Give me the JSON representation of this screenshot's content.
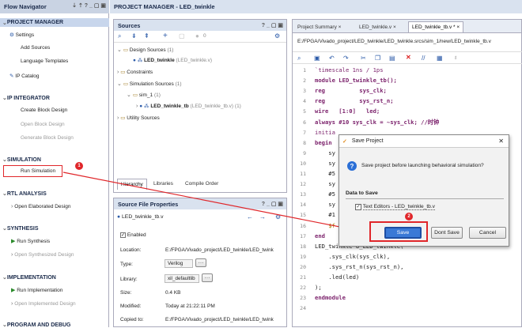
{
  "flow_nav": {
    "title": "Flow Navigator",
    "sections": {
      "project_manager": "PROJECT MANAGER",
      "ip_integrator": "IP INTEGRATOR",
      "simulation": "SIMULATION",
      "rtl_analysis": "RTL ANALYSIS",
      "synthesis": "SYNTHESIS",
      "implementation": "IMPLEMENTATION",
      "program_debug": "PROGRAM AND DEBUG"
    },
    "items": {
      "settings": "Settings",
      "add_sources": "Add Sources",
      "language_templates": "Language Templates",
      "ip_catalog": "IP Catalog",
      "create_block": "Create Block Design",
      "open_block": "Open Block Design",
      "generate_block": "Generate Block Design",
      "run_sim": "Run Simulation",
      "open_elab": "Open Elaborated Design",
      "run_synth": "Run Synthesis",
      "open_synth": "Open Synthesized Design",
      "run_impl": "Run Implementation",
      "open_impl": "Open Implemented Design"
    }
  },
  "pm_header": "PROJECT MANAGER - LED_twinkle",
  "sources": {
    "title": "Sources",
    "count": "0",
    "design_sources": "Design Sources",
    "design_count": "(1)",
    "led_twinkle": "LED_twinkle",
    "led_twinkle_file": "(LED_twinkle.v)",
    "constraints": "Constraints",
    "sim_sources": "Simulation Sources",
    "sim_count": "(1)",
    "sim_1": "sim_1",
    "sim_1_count": "(1)",
    "tb": "LED_twinkle_tb",
    "tb_file": "(LED_twinkle_tb.v) (1)",
    "utility": "Utility Sources",
    "tabs": [
      "Hierarchy",
      "Libraries",
      "Compile Order"
    ]
  },
  "sfp": {
    "title": "Source File Properties",
    "file": "LED_twinkle_tb.v",
    "enabled": "Enabled",
    "location_label": "Location:",
    "location": "E:/FPGA/Vivado_project/LED_twinkle/LED_twink",
    "type_label": "Type:",
    "type": "Verilog",
    "library_label": "Library:",
    "library": "xil_defaultlib",
    "size_label": "Size:",
    "size": "0.4 KB",
    "modified_label": "Modified:",
    "modified": "Today at 21:22:11 PM",
    "copied_label": "Copied to:",
    "copied": "E:/FPGA/Vivado_project/LED_twinkle/LED_twink"
  },
  "editor": {
    "tabs": [
      "Project Summary",
      "LED_twinkle.v",
      "LED_twinkle_tb.v *"
    ],
    "path": "E:/FPGA/Vivado_project/LED_twinkle/LED_twinkle.srcs/sim_1/new/LED_twinkle_tb.v",
    "line_numbers": [
      "1",
      "2",
      "3",
      "4",
      "5",
      "6",
      "7",
      "8",
      "9",
      "10",
      "11",
      "12",
      "13",
      "14",
      "15",
      "16",
      "17",
      "18",
      "19",
      "20",
      "21",
      "22",
      "23",
      "24"
    ],
    "lines": [
      "`timescale 1ns / 1ps",
      "module LED_twinkle_tb();",
      "reg          sys_clk;",
      "reg          sys_rst_n;",
      "wire   [1:0]   led;",
      "always #10 sys_clk = ~sys_clk; //时钟",
      "initia",
      "begin",
      "    sy",
      "    sy",
      "    #5",
      "    sy",
      "    #5",
      "    sy",
      "    #1",
      "    $f",
      "end",
      "LED_twinkle U_LED_twinkle(",
      "    .sys_clk(sys_clk),",
      "    .sys_rst_n(sys_rst_n),",
      "    .led(led)",
      ");",
      "endmodule",
      ""
    ]
  },
  "dialog": {
    "title": "Save Project",
    "question": "Save project before launching behavioral simulation?",
    "data_to_save": "Data to Save",
    "item": "Text Editors - LED_twinkle_tb.v",
    "save": "Save",
    "dont_save": "Dont Save",
    "cancel": "Cancel"
  },
  "badges": {
    "one": "1",
    "two": "2"
  }
}
